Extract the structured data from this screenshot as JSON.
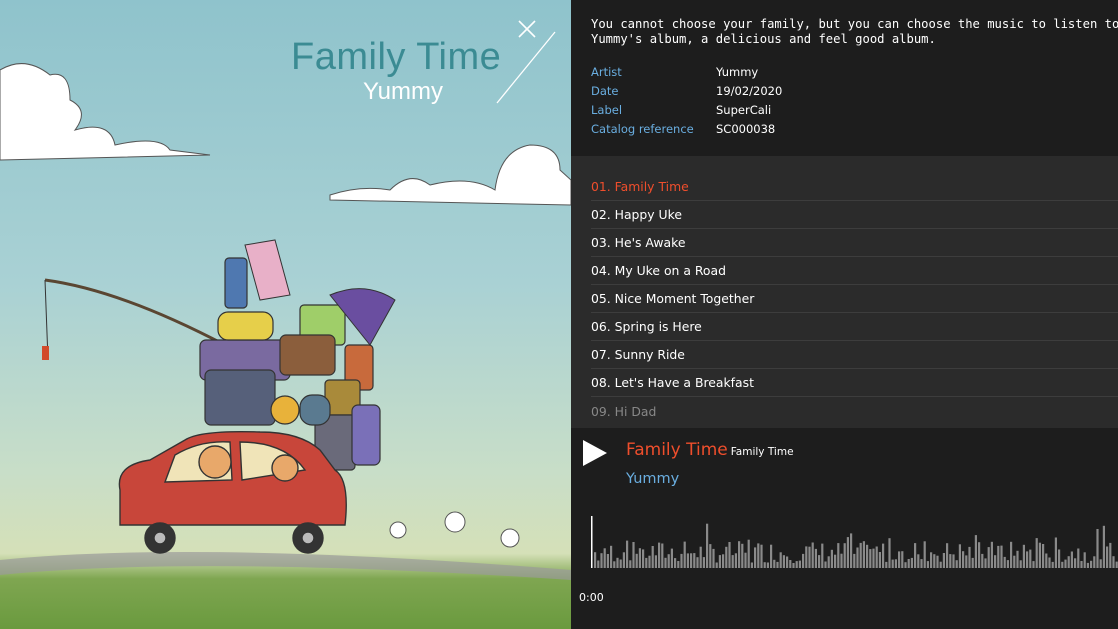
{
  "cover": {
    "title": "Family Time",
    "artist": "Yummy"
  },
  "info": {
    "description": "You cannot choose your family, but you can choose the music to listen to while Yummy's album, a delicious and feel good album.",
    "description_line1": "You cannot choose your family, but you can choose the music to listen to while",
    "description_line2": "Yummy's album, a delicious and feel good album.",
    "meta": [
      {
        "key": "Artist",
        "value": "Yummy"
      },
      {
        "key": "Date",
        "value": "19/02/2020"
      },
      {
        "key": "Label",
        "value": "SuperCali"
      },
      {
        "key": "Catalog reference",
        "value": "SC000038"
      }
    ]
  },
  "tracks": [
    {
      "label": "01. Family Time",
      "active": true
    },
    {
      "label": "02. Happy Uke",
      "active": false
    },
    {
      "label": "03. He's Awake",
      "active": false
    },
    {
      "label": "04. My Uke on a Road",
      "active": false
    },
    {
      "label": "05. Nice Moment Together",
      "active": false
    },
    {
      "label": "06. Spring is Here",
      "active": false
    },
    {
      "label": "07. Sunny Ride",
      "active": false
    },
    {
      "label": "08. Let's Have a Breakfast",
      "active": false
    },
    {
      "label": "09. Hi Dad",
      "active": false
    }
  ],
  "player": {
    "track_title": "Family Time",
    "album_title": "Family Time",
    "artist": "Yummy",
    "time": "0:00",
    "progress": 0
  },
  "colors": {
    "accent": "#ef4e2c",
    "link": "#6aaee0",
    "title_teal": "#3b8b93"
  }
}
